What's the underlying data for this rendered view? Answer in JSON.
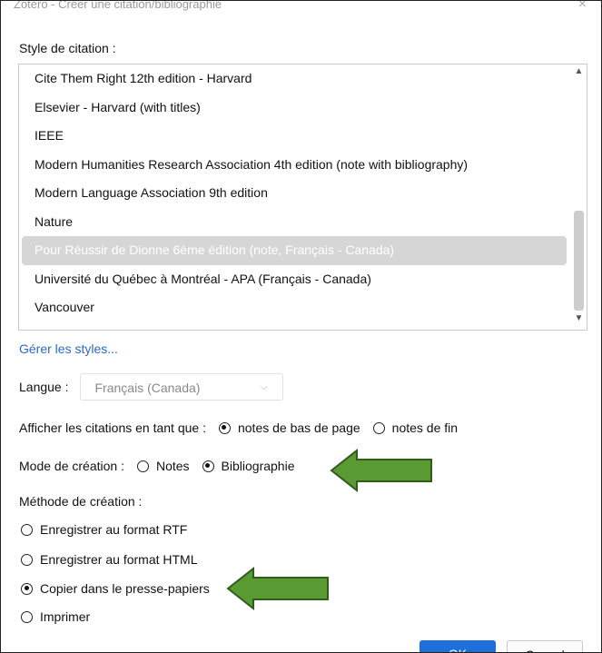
{
  "window": {
    "title": "Zotero - Créer une citation/bibliographie",
    "close_glyph": "×"
  },
  "citation_style": {
    "label": "Style de citation :",
    "items": [
      {
        "label": "Cite Them Right 12th edition - Harvard"
      },
      {
        "label": "Elsevier - Harvard (with titles)"
      },
      {
        "label": "IEEE"
      },
      {
        "label": "Modern Humanities Research Association 4th edition (note with bibliography)"
      },
      {
        "label": "Modern Language Association 9th edition"
      },
      {
        "label": "Nature"
      },
      {
        "label": "Pour Réussir de Dionne 6ème édition (note, Français - Canada)"
      },
      {
        "label": "Université du Québec à Montréal - APA (Français - Canada)"
      },
      {
        "label": "Vancouver"
      }
    ],
    "selected_index": 6,
    "manage_link": "Gérer les styles..."
  },
  "language": {
    "label": "Langue :",
    "value": "Français (Canada)"
  },
  "display_citations": {
    "label": "Afficher les citations en tant que :",
    "options": [
      "notes de bas de page",
      "notes de fin"
    ],
    "selected": "notes de bas de page"
  },
  "creation_mode": {
    "label": "Mode de création :",
    "options": [
      "Notes",
      "Bibliographie"
    ],
    "selected": "Bibliographie"
  },
  "creation_method": {
    "label": "Méthode de création :",
    "options": [
      "Enregistrer au format RTF",
      "Enregistrer au format HTML",
      "Copier dans le presse-papiers",
      "Imprimer"
    ],
    "selected": "Copier dans le presse-papiers"
  },
  "buttons": {
    "ok": "OK",
    "cancel": "Cancel"
  },
  "colors": {
    "accent": "#1e6fd9",
    "arrow_fill": "#5a9a32",
    "arrow_stroke": "#2e5e17",
    "selection": "#d6d6d6"
  }
}
